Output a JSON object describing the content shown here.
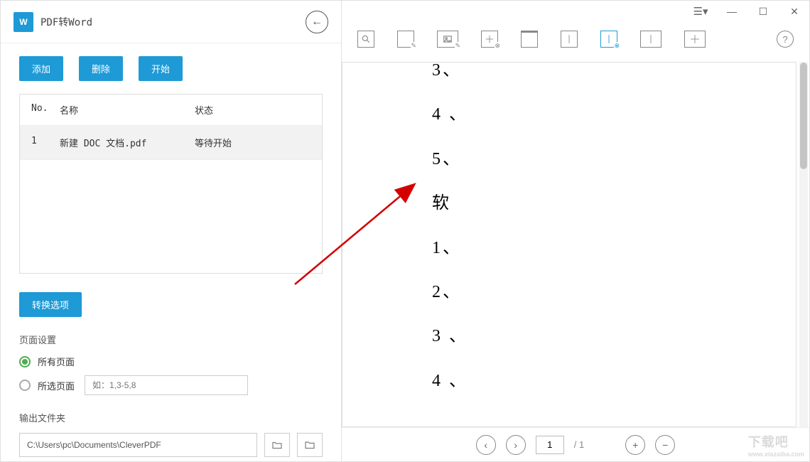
{
  "header": {
    "title": "PDF转Word",
    "word_icon_label": "W"
  },
  "buttons": {
    "add": "添加",
    "delete": "删除",
    "start": "开始",
    "options": "转换选项"
  },
  "table": {
    "col_no": "No.",
    "col_name": "名称",
    "col_status": "状态",
    "rows": [
      {
        "no": "1",
        "name": "新建 DOC 文档.pdf",
        "status": "等待开始"
      }
    ]
  },
  "page_settings": {
    "label": "页面设置",
    "all_pages": "所有页面",
    "selected_pages": "所选页面",
    "range_placeholder": "如：1,3-5,8"
  },
  "output": {
    "label": "输出文件夹",
    "path": "C:\\Users\\pc\\Documents\\CleverPDF"
  },
  "preview": {
    "lines": [
      "3、",
      "4 、",
      "5、",
      "软",
      "1、",
      "2、",
      "3 、",
      "4 、"
    ]
  },
  "pager": {
    "current": "1",
    "total": "/ 1"
  },
  "watermark": {
    "main": "下载吧",
    "sub": "www.xiazaiba.com"
  }
}
